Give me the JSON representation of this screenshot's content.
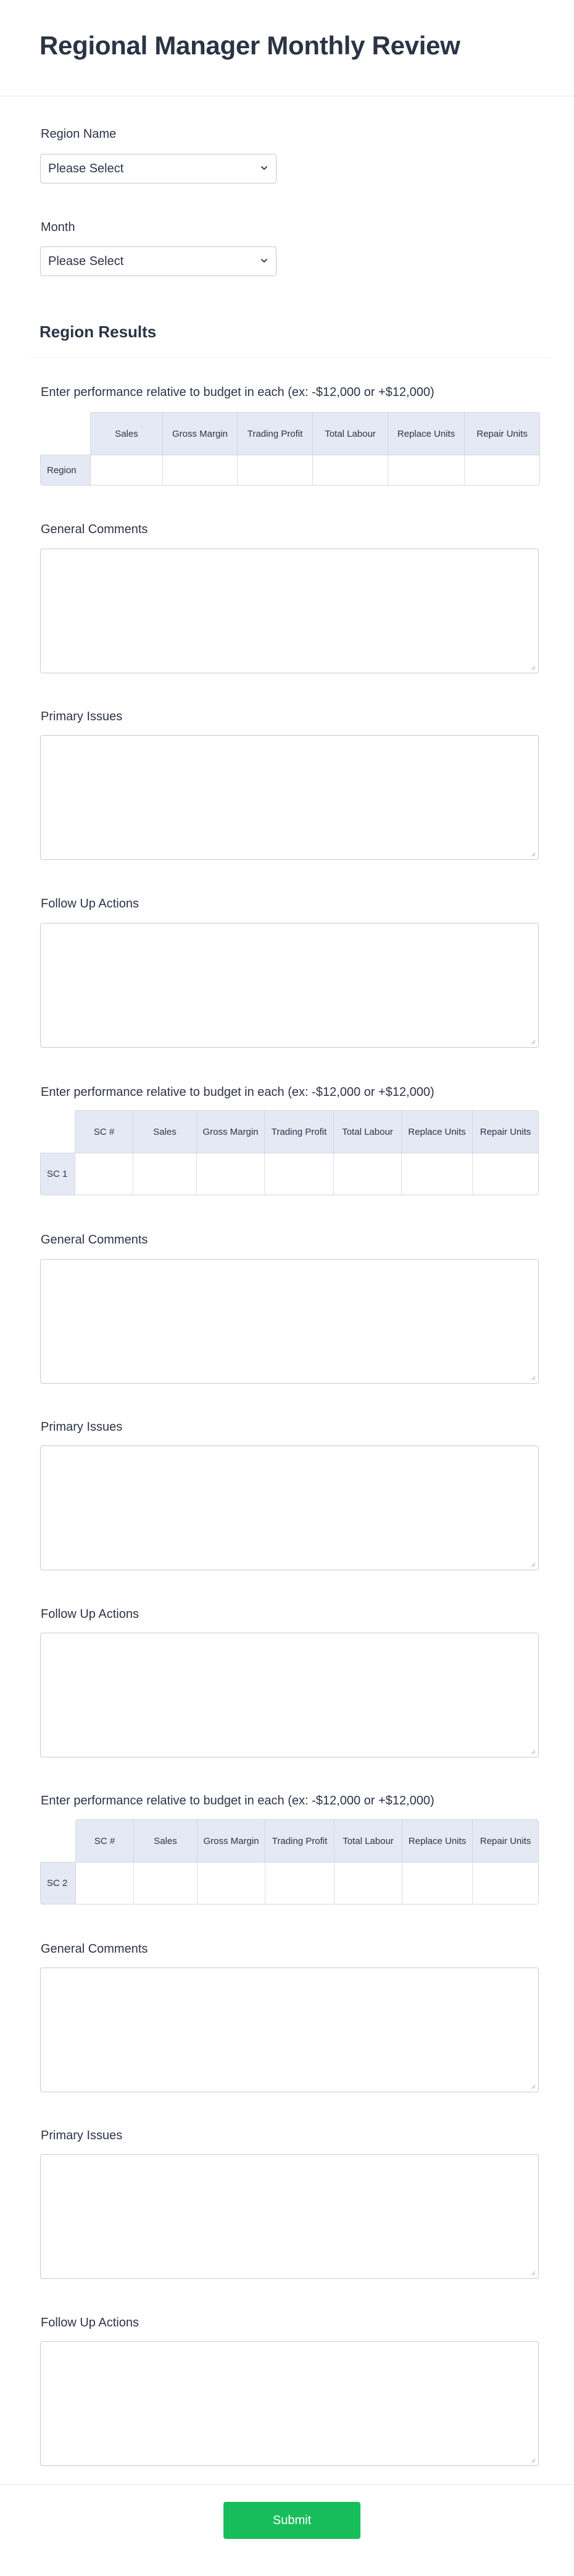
{
  "header": {
    "title": "Regional Manager Monthly Review"
  },
  "fields": {
    "region_name": {
      "label": "Region Name",
      "value": "Please Select"
    },
    "month": {
      "label": "Month",
      "value": "Please Select"
    }
  },
  "region_results": {
    "title": "Region Results"
  },
  "blocks": [
    {
      "instruction": "Enter performance relative to budget in each (ex: -$12,000 or +$12,000)",
      "columns": [
        "Sales",
        "Gross Margin",
        "Trading Profit",
        "Total Labour",
        "Replace Units",
        "Repair Units"
      ],
      "row_label": "Region",
      "general_comments_label": "General Comments",
      "primary_issues_label": "Primary Issues",
      "follow_up_label": "Follow Up Actions"
    },
    {
      "instruction": "Enter performance relative to budget in each (ex: -$12,000 or +$12,000)",
      "columns": [
        "SC #",
        "Sales",
        "Gross Margin",
        "Trading Profit",
        "Total Labour",
        "Replace Units",
        "Repair Units"
      ],
      "row_label": "SC 1",
      "general_comments_label": "General Comments",
      "primary_issues_label": "Primary Issues",
      "follow_up_label": "Follow Up Actions"
    },
    {
      "instruction": "Enter performance relative to budget in each (ex: -$12,000 or +$12,000)",
      "columns": [
        "SC #",
        "Sales",
        "Gross Margin",
        "Trading Profit",
        "Total Labour",
        "Replace Units",
        "Repair Units"
      ],
      "row_label": "SC 2",
      "general_comments_label": "General Comments",
      "primary_issues_label": "Primary Issues",
      "follow_up_label": "Follow Up Actions"
    }
  ],
  "submit": {
    "label": "Submit"
  },
  "colors": {
    "accent": "#18bd5b",
    "header_cell": "#e5e9f4",
    "text": "#2c3345",
    "border": "#c3cad8"
  },
  "icons": {
    "select_chevron": "chevron-down-icon",
    "textarea_grip": "resize-grip-icon"
  }
}
